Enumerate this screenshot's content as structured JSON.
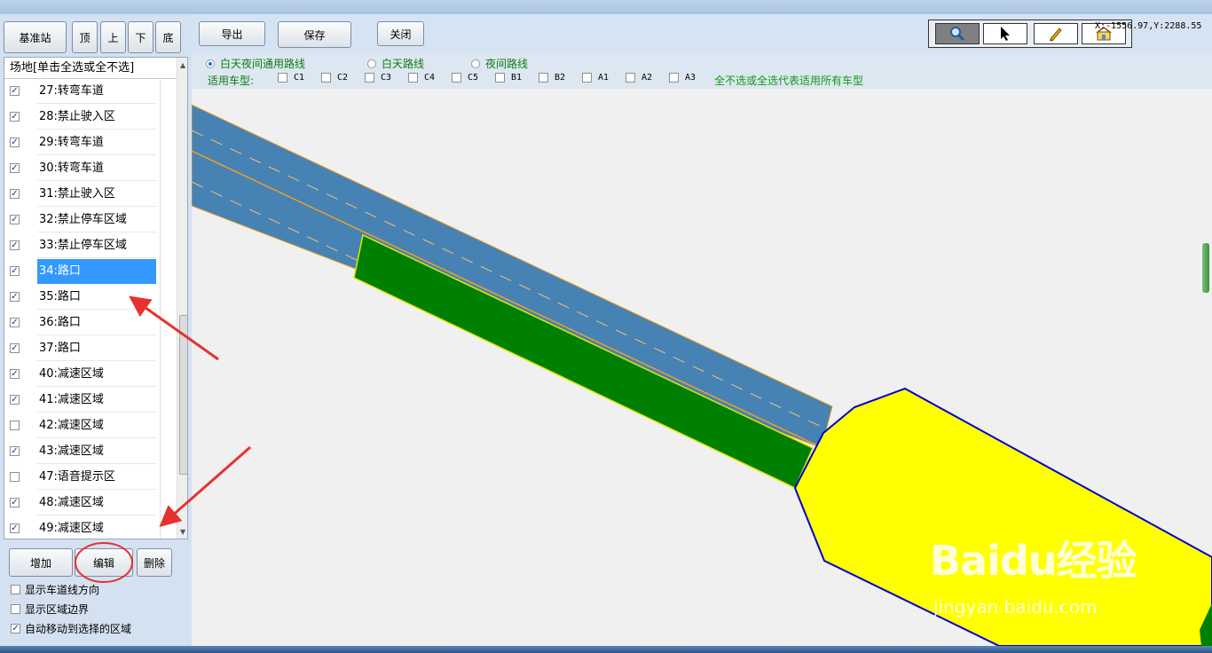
{
  "toolbar_left": {
    "base_station": "基准站",
    "top": "顶",
    "up": "上",
    "down": "下",
    "bottom": "底"
  },
  "toolbar": {
    "export": "导出",
    "save": "保存",
    "close": "关闭"
  },
  "tools": [
    "zoom-icon",
    "pointer-icon",
    "pencil-icon",
    "move-icon"
  ],
  "coordinate": "X:-1556.97,Y:2288.55",
  "list": {
    "header": "场地[单击全选或全不选]",
    "items": [
      {
        "label": "27:转弯车道",
        "checked": true
      },
      {
        "label": "28:禁止驶入区",
        "checked": true
      },
      {
        "label": "29:转弯车道",
        "checked": true
      },
      {
        "label": "30:转弯车道",
        "checked": true
      },
      {
        "label": "31:禁止驶入区",
        "checked": true
      },
      {
        "label": "32:禁止停车区域",
        "checked": true
      },
      {
        "label": "33:禁止停车区域",
        "checked": true
      },
      {
        "label": "34:路口",
        "checked": true,
        "selected": true
      },
      {
        "label": "35:路口",
        "checked": true
      },
      {
        "label": "36:路口",
        "checked": true
      },
      {
        "label": "37:路口",
        "checked": true
      },
      {
        "label": "40:减速区域",
        "checked": true
      },
      {
        "label": "41:减速区域",
        "checked": true
      },
      {
        "label": "42:减速区域",
        "checked": false
      },
      {
        "label": "43:减速区域",
        "checked": true
      },
      {
        "label": "47:语音提示区",
        "checked": false
      },
      {
        "label": "48:减速区域",
        "checked": true
      },
      {
        "label": "49:减速区域",
        "checked": true
      }
    ]
  },
  "actions": {
    "add": "增加",
    "edit": "编辑",
    "delete": "删除"
  },
  "options": [
    {
      "label": "显示车道线方向",
      "checked": false
    },
    {
      "label": "显示区域边界",
      "checked": false
    },
    {
      "label": "自动移动到选择的区域",
      "checked": true
    }
  ],
  "routes": {
    "all": "白天夜间通用路线",
    "day": "白天路线",
    "night": "夜间路线",
    "selected": "all"
  },
  "vehicle": {
    "label": "适用车型:",
    "types": [
      "C1",
      "C2",
      "C3",
      "C4",
      "C5",
      "B1",
      "B2",
      "A1",
      "A2",
      "A3"
    ],
    "hint": "全不选或全选代表适用所有车型"
  },
  "colors": {
    "road": "#4682b4",
    "green_zone": "#008000",
    "intersection": "#ffff00",
    "intersection_border": "#0000cd",
    "lane_line": "#f0a020",
    "selected": "#3399ff",
    "annotation": "#e83030"
  },
  "watermark": {
    "brand": "Baidu经验",
    "url": "jingyan.baidu.com"
  }
}
